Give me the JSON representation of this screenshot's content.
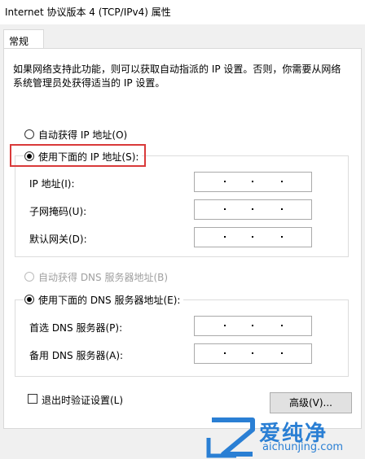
{
  "window": {
    "title": "Internet 协议版本 4 (TCP/IPv4) 属性"
  },
  "tabs": [
    {
      "label": "常规"
    }
  ],
  "description": "如果网络支持此功能，则可以获取自动指派的 IP 设置。否则，你需要从网络系统管理员处获得适当的 IP 设置。",
  "ip_section": {
    "auto_label": "自动获得 IP 地址(O)",
    "manual_label": "使用下面的 IP 地址(S):",
    "selected": "manual",
    "fields": [
      {
        "label": "IP 地址(I):",
        "value": ""
      },
      {
        "label": "子网掩码(U):",
        "value": ""
      },
      {
        "label": "默认网关(D):",
        "value": ""
      }
    ]
  },
  "dns_section": {
    "auto_label": "自动获得 DNS 服务器地址(B)",
    "manual_label": "使用下面的 DNS 服务器地址(E):",
    "selected": "manual",
    "fields": [
      {
        "label": "首选 DNS 服务器(P):",
        "value": ""
      },
      {
        "label": "备用 DNS 服务器(A):",
        "value": ""
      }
    ]
  },
  "validate_on_exit": {
    "label": "退出时验证设置(L)",
    "checked": false
  },
  "advanced_button": {
    "label": "高级(V)..."
  },
  "watermark": {
    "text": "爱纯净",
    "domain": "aichunjing.com"
  },
  "colors": {
    "highlight": "#d93a3a",
    "watermark": "#2a7fd4"
  }
}
